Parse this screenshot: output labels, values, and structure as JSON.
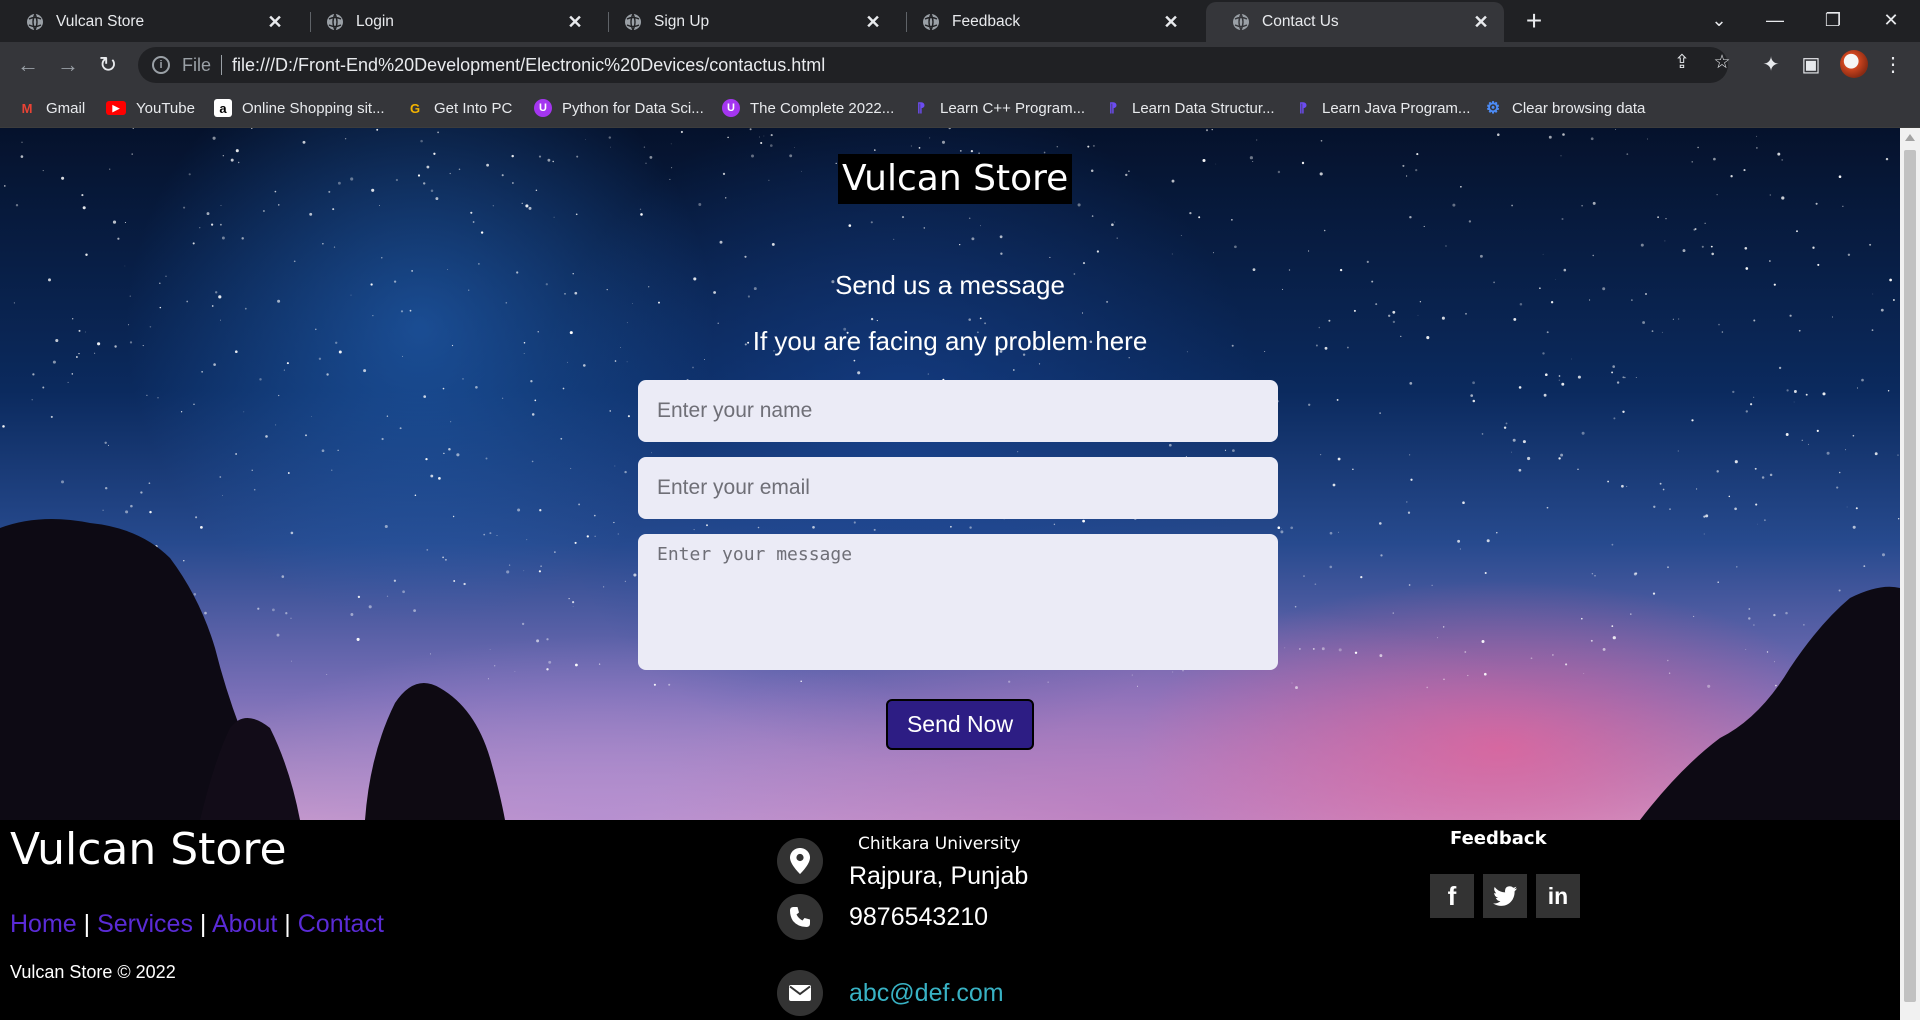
{
  "browser": {
    "tabs": [
      {
        "title": "Vulcan Store",
        "active": false
      },
      {
        "title": "Login",
        "active": false
      },
      {
        "title": "Sign Up",
        "active": false
      },
      {
        "title": "Feedback",
        "active": false
      },
      {
        "title": "Contact Us",
        "active": true
      }
    ],
    "address": {
      "scheme": "File",
      "url": "file:///D:/Front-End%20Development/Electronic%20Devices/contactus.html"
    },
    "bookmarks": [
      {
        "label": "Gmail",
        "icon": "gmail-icon"
      },
      {
        "label": "YouTube",
        "icon": "youtube-icon"
      },
      {
        "label": "Online Shopping sit...",
        "icon": "amazon-icon"
      },
      {
        "label": "Get Into PC",
        "icon": "getintopc-icon"
      },
      {
        "label": "Python for Data Sci...",
        "icon": "udemy-icon"
      },
      {
        "label": "The Complete 2022...",
        "icon": "udemy-icon"
      },
      {
        "label": "Learn C++ Program...",
        "icon": "programiz-icon"
      },
      {
        "label": "Learn Data Structur...",
        "icon": "programiz-icon"
      },
      {
        "label": "Learn Java Program...",
        "icon": "programiz-icon"
      },
      {
        "label": "Clear browsing data",
        "icon": "gear-icon"
      }
    ]
  },
  "page": {
    "brand": "Vulcan Store",
    "heading": "Send us a message",
    "subheading": "If you are facing any problem here",
    "form": {
      "name_placeholder": "Enter your name",
      "email_placeholder": "Enter your email",
      "message_placeholder": "Enter your message",
      "submit_label": "Send Now"
    }
  },
  "footer": {
    "brand": "Vulcan Store",
    "links": [
      "Home",
      "Services",
      "About",
      "Contact"
    ],
    "separator": "|",
    "copyright": "Vulcan Store © 2022",
    "contact": {
      "university": "Chitkara University",
      "location": "Rajpura, Punjab",
      "phone": "9876543210",
      "email": "abc@def.com"
    },
    "feedback_title": "Feedback",
    "social": [
      {
        "icon": "facebook-icon",
        "glyph": "f"
      },
      {
        "icon": "twitter-icon",
        "glyph": ""
      },
      {
        "icon": "linkedin-icon",
        "glyph": "in"
      }
    ]
  },
  "colors": {
    "link_purple": "#5a2bd6",
    "button_bg": "#2d1d84",
    "email_teal": "#38b2c4"
  }
}
